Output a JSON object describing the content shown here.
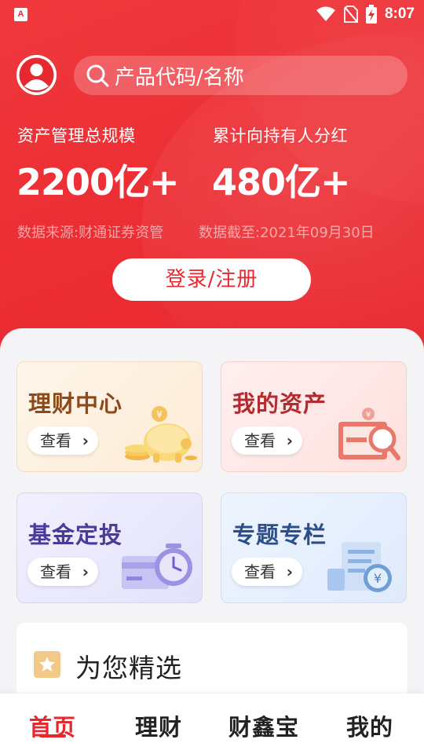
{
  "status_bar": {
    "app_icon": "A",
    "time": "8:07",
    "icons": [
      "wifi-icon",
      "no-sim-icon",
      "battery-charging-icon"
    ]
  },
  "header": {
    "search_placeholder": "产品代码/名称",
    "avatar_icon": "user-avatar-icon"
  },
  "stats": [
    {
      "label": "资产管理总规模",
      "value": "2200亿+"
    },
    {
      "label": "累计向持有人分红",
      "value": "480亿+"
    }
  ],
  "source_note": "数据来源:财通证券资管",
  "date_note": "数据截至:2021年09月30日",
  "login_label": "登录/注册",
  "cards": [
    {
      "title": "理财中心",
      "button": "查看",
      "icon": "piggy-bank-icon"
    },
    {
      "title": "我的资产",
      "button": "查看",
      "icon": "wallet-magnifier-icon"
    },
    {
      "title": "基金定投",
      "button": "查看",
      "icon": "card-clock-icon"
    },
    {
      "title": "专题专栏",
      "button": "查看",
      "icon": "document-yuan-icon"
    }
  ],
  "picks": {
    "title": "为您精选",
    "icon": "star-badge-icon"
  },
  "tabs": [
    {
      "label": "首页",
      "active": true
    },
    {
      "label": "理财",
      "active": false
    },
    {
      "label": "财鑫宝",
      "active": false
    },
    {
      "label": "我的",
      "active": false
    }
  ],
  "colors": {
    "brand_red": "#e8282f",
    "card_licai": "#fdebd6",
    "card_zichan": "#fde0de",
    "card_jijin": "#e3e2fb",
    "card_zhuanti": "#dfeafb"
  }
}
